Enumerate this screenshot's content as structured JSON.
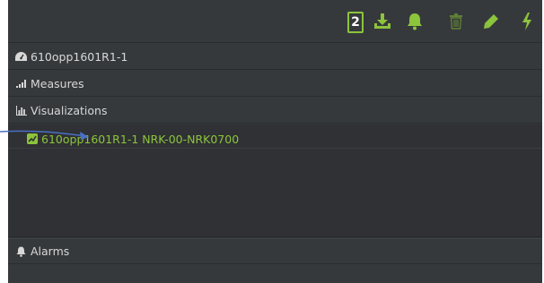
{
  "toolbar": {
    "count": "2",
    "icons": [
      "download-icon",
      "bell-icon",
      "trash-icon",
      "pencil-icon",
      "bolt-icon"
    ],
    "accent_color": "#8cc43c"
  },
  "device": {
    "name": "610opp1601R1-1",
    "icon": "dashboard-icon"
  },
  "sections": {
    "measures": "Measures",
    "visualizations": "Visualizations",
    "alarms": "Alarms"
  },
  "visualization_items": [
    {
      "label": "610opp1601R1-1 NRK-00-NRK0700",
      "icon": "chart-square-icon"
    }
  ],
  "annotation": {
    "arrow_color": "#4a6fc4"
  }
}
